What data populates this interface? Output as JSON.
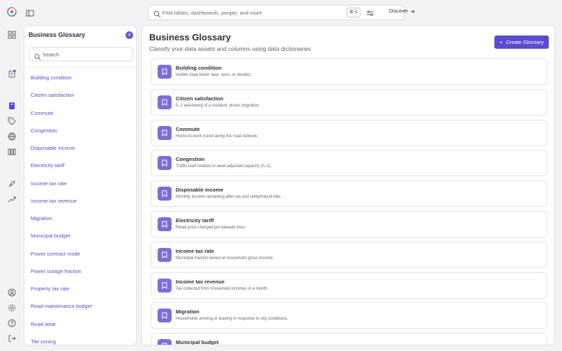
{
  "topbar": {
    "search_placeholder": "Find tables, dashboards, people, and more",
    "shortcut": "⌘ K",
    "discover_label": "Discover"
  },
  "glossary_panel": {
    "title": "Business Glossary",
    "search_placeholder": "Search",
    "items": [
      "Building condition",
      "Citizen satisfaction",
      "Commute",
      "Congestion",
      "Disposable income",
      "Electricity tariff",
      "Income tax rate",
      "Income tax revenue",
      "Migration",
      "Municipal budget",
      "Power contract mode",
      "Power outage fraction",
      "Property tax rate",
      "Road maintenance budget",
      "Road wear",
      "Tile zoning"
    ]
  },
  "main": {
    "title": "Business Glossary",
    "subtitle": "Classify your data assets and columns using data dictionaries",
    "create_label": "Create Glossary",
    "cards": [
      {
        "name": "Building condition",
        "desc": "Visible state band: new, worn, or derelict."
      },
      {
        "name": "Citizen satisfaction",
        "desc": "0–1 well-being of a resident; drives migration."
      },
      {
        "name": "Commute",
        "desc": "Home-to-work travel along the road network."
      },
      {
        "name": "Congestion",
        "desc": "Traffic load relative to wear-adjusted capacity (0–1)."
      },
      {
        "name": "Disposable income",
        "desc": "Monthly income remaining after tax and utility/transit bills."
      },
      {
        "name": "Electricity tariff",
        "desc": "Retail price charged per kilowatt-hour."
      },
      {
        "name": "Income tax rate",
        "desc": "Municipal fraction levied on household gross income."
      },
      {
        "name": "Income tax revenue",
        "desc": "Tax collected from household incomes in a month."
      },
      {
        "name": "Migration",
        "desc": "Households arriving or leaving in response to city conditions."
      },
      {
        "name": "Municipal budget",
        "desc": ""
      }
    ]
  },
  "colors": {
    "accent": "#5a4bd0",
    "link": "#5b4fc7",
    "card_icon": "#7b6ed8"
  }
}
